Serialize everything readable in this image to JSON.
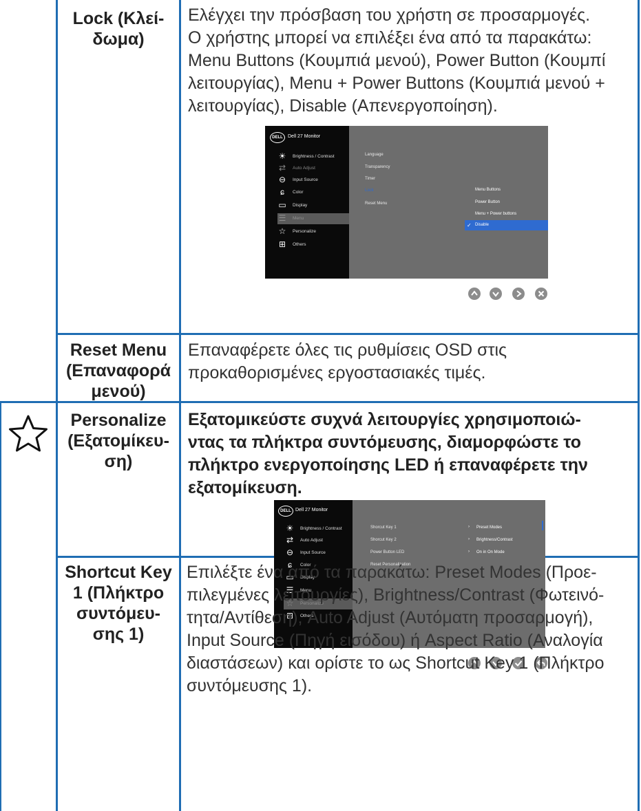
{
  "rows": [
    {
      "label": "Lock (Κλεί-\nδωμα)",
      "label_lines": [
        "Lock (Κλεί-",
        "δωμα)"
      ],
      "desc_lines": [
        "Ελέγχει την πρόσβαση του χρήστη σε προσαρμογές.",
        "Ο χρήστης μπορεί να επιλέξει ένα από τα παρακάτω:",
        "Menu Buttons (Κουμπιά μενού), Power Button (Κουμπί",
        "λειτουργίας), Menu + Power Buttons (Κουμπιά μενού +",
        "λειτουργίας), Disable (Απενεργοποίηση)."
      ]
    },
    {
      "label_lines": [
        "Reset Menu",
        "(Επαναφορά",
        "μενού)"
      ],
      "desc_lines": [
        "Επαναφέρετε όλες τις ρυθμίσεις OSD στις",
        "προκαθορισμένες εργοστασιακές τιμές."
      ]
    },
    {
      "icon": "star-outline-icon",
      "label_lines": [
        "Personalize",
        "(Εξατομίκευ-",
        "ση)"
      ],
      "desc_lines": [
        "Εξατομικεύστε συχνά λειτουργίες χρησιμοποιώ-",
        "ντας τα πλήκτρα συντόμευσης, διαμορφώστε το",
        "πλήκτρο ενεργοποίησης LED ή επαναφέρετε την",
        "εξατομίκευση."
      ]
    },
    {
      "label_lines": [
        "Shortcut Key",
        "1 (Πλήκτρο",
        "συντόμευ-",
        "σης 1)"
      ],
      "desc_lines": [
        "Επιλέξτε ένα από τα παρακάτω: Preset Modes (Προε-",
        "πιλεγμένες λειτουργίες), Brightness/Contrast (Φωτεινό-",
        "τητα/Αντίθεση), Auto Adjust (Αυτόματη προσαρμογή),",
        "Input Source (Πηγή εισόδου) ή Aspect Ratio (Αναλογία",
        "διαστάσεων) και ορίστε το ως Shortcut Key 1 (Πλήκτρο",
        "συντόμευσης 1)."
      ]
    }
  ],
  "osd1": {
    "logo": "DELL",
    "title": "Dell 27 Monitor",
    "menu": [
      "Brightness / Contrast",
      "Auto Adjust",
      "Input Source",
      "Color",
      "Display",
      "Menu",
      "Personalize",
      "Others"
    ],
    "selected": "Menu",
    "submenu": [
      "Language",
      "Transparency",
      "Timer",
      "Lock",
      "Reset Menu"
    ],
    "options": [
      "Menu Buttons",
      "Power Button",
      "Menu + Power buttons",
      "Disable"
    ],
    "checked_option": "Disable"
  },
  "osd2": {
    "logo": "DELL",
    "title": "Dell 27 Monitor",
    "menu": [
      "Brightness / Contrast",
      "Auto Adjust",
      "Input Source",
      "Color",
      "Display",
      "Menu",
      "Personalize",
      "Others"
    ],
    "selected": "Personalize",
    "submenu": [
      "Shorcut Key 1",
      "Shorcut Key 2",
      "Power Button LED",
      "Reset Personalization"
    ],
    "values": [
      "Preset Modes",
      "Brightness/Contrast",
      "On in On Mode"
    ]
  },
  "nav1": [
    "up-icon",
    "down-icon",
    "right-icon",
    "close-icon"
  ],
  "nav2": [
    "up-icon",
    "down-icon",
    "check-icon",
    "back-icon"
  ],
  "colors": {
    "rule": "#1f6db3",
    "osd_bg": "#6d6d6d",
    "osd_side": "#0a0a0a",
    "highlight": "#2f6bd0",
    "nav": "#8c8c8c"
  }
}
